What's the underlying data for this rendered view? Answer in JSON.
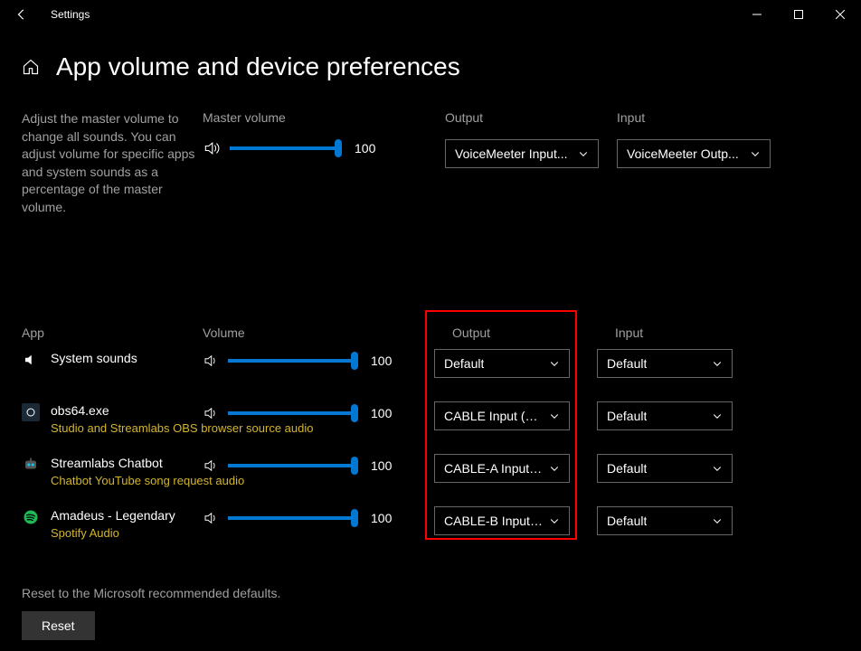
{
  "window": {
    "title": "Settings"
  },
  "page": {
    "title": "App volume and device preferences",
    "help": "Adjust the master volume to change all sounds. You can adjust volume for specific apps and system sounds as a percentage of the master volume."
  },
  "master": {
    "label": "Master volume",
    "value": "100",
    "output_label": "Output",
    "output_value": "VoiceMeeter Input...",
    "input_label": "Input",
    "input_value": "VoiceMeeter Outp..."
  },
  "columns": {
    "app": "App",
    "volume": "Volume",
    "output": "Output",
    "input": "Input"
  },
  "apps": [
    {
      "name": "System sounds",
      "sub": "",
      "volume": "100",
      "output": "Default",
      "input": "Default",
      "icon": "system"
    },
    {
      "name": "obs64.exe",
      "sub": "Studio and Streamlabs OBS browser source audio",
      "volume": "100",
      "output": "CABLE Input (VB-/",
      "input": "Default",
      "icon": "obs"
    },
    {
      "name": "Streamlabs Chatbot",
      "sub": "Chatbot YouTube song request audio",
      "volume": "100",
      "output": "CABLE-A Input (V",
      "input": "Default",
      "icon": "chatbot"
    },
    {
      "name": "Amadeus - Legendary",
      "sub": "Spotify Audio",
      "volume": "100",
      "output": "CABLE-B Input (VI",
      "input": "Default",
      "icon": "spotify"
    }
  ],
  "reset": {
    "text": "Reset to the Microsoft recommended defaults.",
    "button": "Reset"
  }
}
